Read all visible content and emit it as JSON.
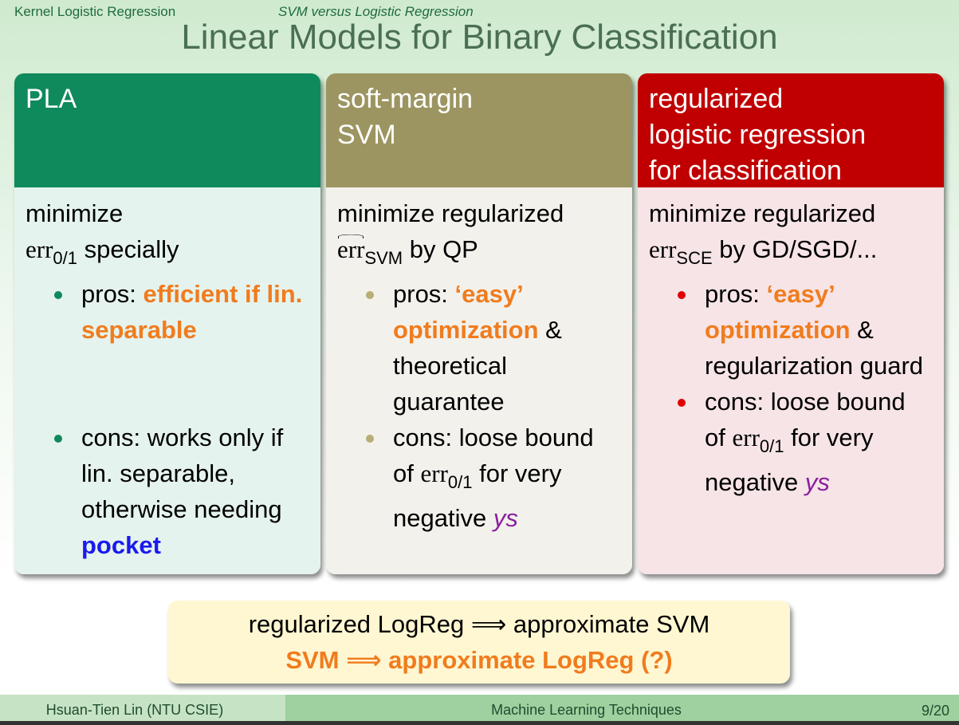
{
  "header": {
    "section": "Kernel Logistic Regression",
    "subsection": "SVM versus Logistic Regression"
  },
  "title": "Linear Models for Binary Classification",
  "cards": [
    {
      "head": [
        "PLA"
      ],
      "line1": "minimize",
      "err_name": "err",
      "err_sub": "0/1",
      "method": "specially",
      "pros_prefix": "pros: ",
      "pros_highlight": "efficient if lin. separable",
      "pros_suffix": "",
      "pros_rest": "",
      "cons_text": "cons: works only if lin. separable, otherwise needing ",
      "cons_highlight": "pocket"
    },
    {
      "head": [
        "soft-margin",
        "SVM"
      ],
      "line1": "minimize regularized",
      "err_name": "err",
      "err_sub": "SVM",
      "method": "by QP",
      "pros_prefix": "pros: ",
      "pros_highlight": "‘easy’ optimization",
      "pros_suffix": " &",
      "pros_rest": "theoretical guarantee",
      "cons_text": "cons: loose bound of",
      "cons_err": "err",
      "cons_sub": "0/1",
      "cons_for": "for very negative",
      "cons_ys": "ys"
    },
    {
      "head": [
        "regularized",
        "logistic regression",
        "for classification"
      ],
      "line1": "minimize regularized",
      "err_name": "err",
      "err_sub": "SCE",
      "method": "by GD/SGD/...",
      "pros_prefix": "pros: ",
      "pros_highlight": "‘easy’ optimization",
      "pros_suffix": " &",
      "pros_rest": "regularization guard",
      "cons_text": "cons: loose bound of",
      "cons_err": "err",
      "cons_sub": "0/1",
      "cons_for": "for very negative",
      "cons_ys": "ys"
    }
  ],
  "conclusion": {
    "line1": "regularized LogReg ⟹ approximate SVM",
    "line2": "SVM ⟹ approximate LogReg (?)"
  },
  "footer": {
    "author": "Hsuan-Tien Lin  (NTU CSIE)",
    "course": "Machine Learning Techniques",
    "page": "9/20"
  },
  "colors": {
    "pla": "#0f8a5c",
    "svm": "#9c9561",
    "logreg": "#c00000",
    "highlight": "#f07c1e",
    "pocket": "#1a1aee"
  }
}
